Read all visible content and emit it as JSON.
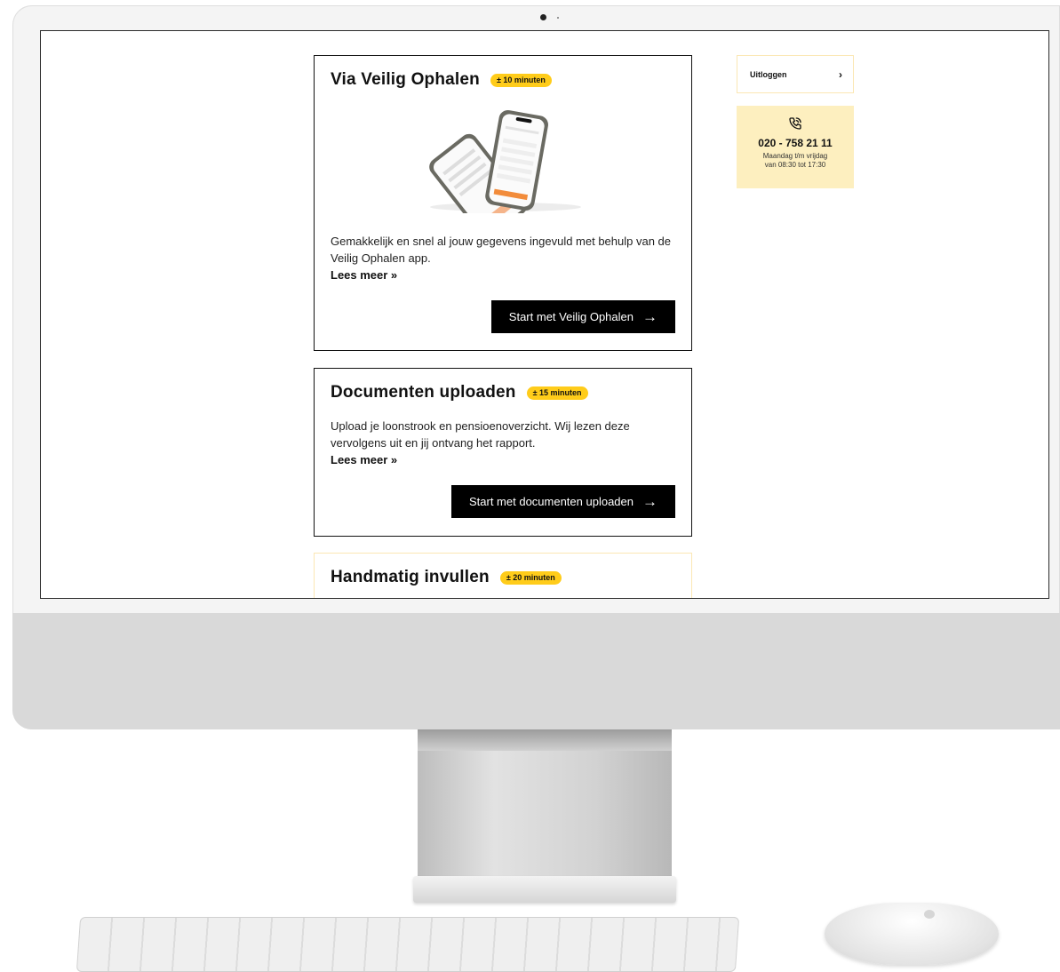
{
  "cards": [
    {
      "title": "Via Veilig Ophalen",
      "badge": "± 10 minuten",
      "text": "Gemakkelijk en snel al jouw gegevens ingevuld met behulp van de Veilig Ophalen app.",
      "link": "Lees meer »",
      "button": "Start met Veilig Ophalen"
    },
    {
      "title": "Documenten uploaden",
      "badge": "± 15 minuten",
      "text": "Upload je loonstrook en pensioenoverzicht. Wij lezen deze vervolgens uit en jij ontvang het rapport.",
      "link": "Lees meer »",
      "button": "Start met documenten uploaden"
    },
    {
      "title": "Handmatig invullen",
      "badge": "± 20 minuten"
    }
  ],
  "sidebar": {
    "logout_label": "Uitloggen",
    "phone_icon": "phone-icon",
    "phone_number": "020 - 758 21 11",
    "hours_line1": "Maandag t/m vrijdag",
    "hours_line2": "van 08:30 tot 17:30"
  },
  "colors": {
    "accent": "#ffcc1a",
    "accent_light": "#fdefbf",
    "button": "#000000"
  }
}
